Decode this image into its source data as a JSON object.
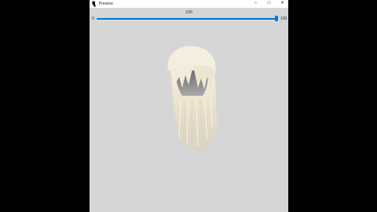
{
  "window": {
    "title": "Preview",
    "minimize_icon": "minimize-icon",
    "maximize_icon": "maximize-icon",
    "close_icon": "close-icon",
    "app_icon": "hair-silhouette-icon"
  },
  "slider": {
    "min_label": "0",
    "max_label": "100",
    "value_label": "100",
    "value": 100,
    "min": 0,
    "max": 100,
    "accent_color": "#0078d4"
  },
  "preview": {
    "subject": "hair-model",
    "background_color": "#d6d6d6"
  }
}
